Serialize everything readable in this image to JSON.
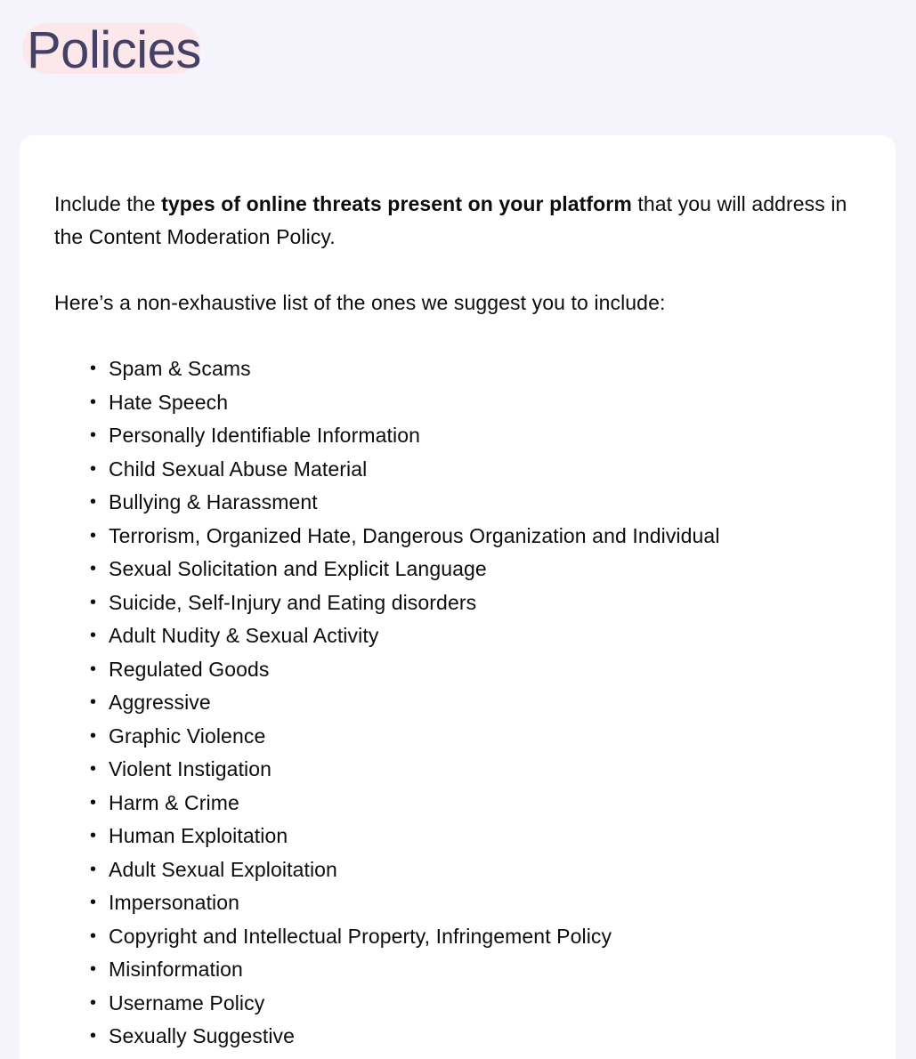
{
  "page": {
    "title": "Policies",
    "background_color": "#f5f4fd",
    "title_color": "#434266",
    "title_highlight_color": "#fce7ea"
  },
  "card": {
    "background_color": "#ffffff",
    "intro": {
      "before_bold": "Include the ",
      "bold": "types of online threats present on your platform",
      "after_bold": " that you will address in the Content Moderation Policy."
    },
    "lead_in": "Here’s a non-exhaustive list of the ones we suggest you to include:",
    "threats": [
      "Spam & Scams",
      "Hate Speech",
      "Personally Identifiable Information",
      "Child Sexual Abuse Material",
      "Bullying & Harassment",
      "Terrorism, Organized Hate, Dangerous Organization and Individual",
      "Sexual Solicitation and Explicit Language",
      "Suicide, Self-Injury and Eating disorders",
      "Adult Nudity & Sexual Activity",
      "Regulated Goods",
      "Aggressive",
      "Graphic Violence",
      "Violent Instigation",
      "Harm & Crime",
      "Human Exploitation",
      "Adult Sexual Exploitation",
      "Impersonation",
      "Copyright and Intellectual Property, Infringement Policy",
      "Misinformation",
      "Username Policy",
      "Sexually Suggestive"
    ]
  }
}
